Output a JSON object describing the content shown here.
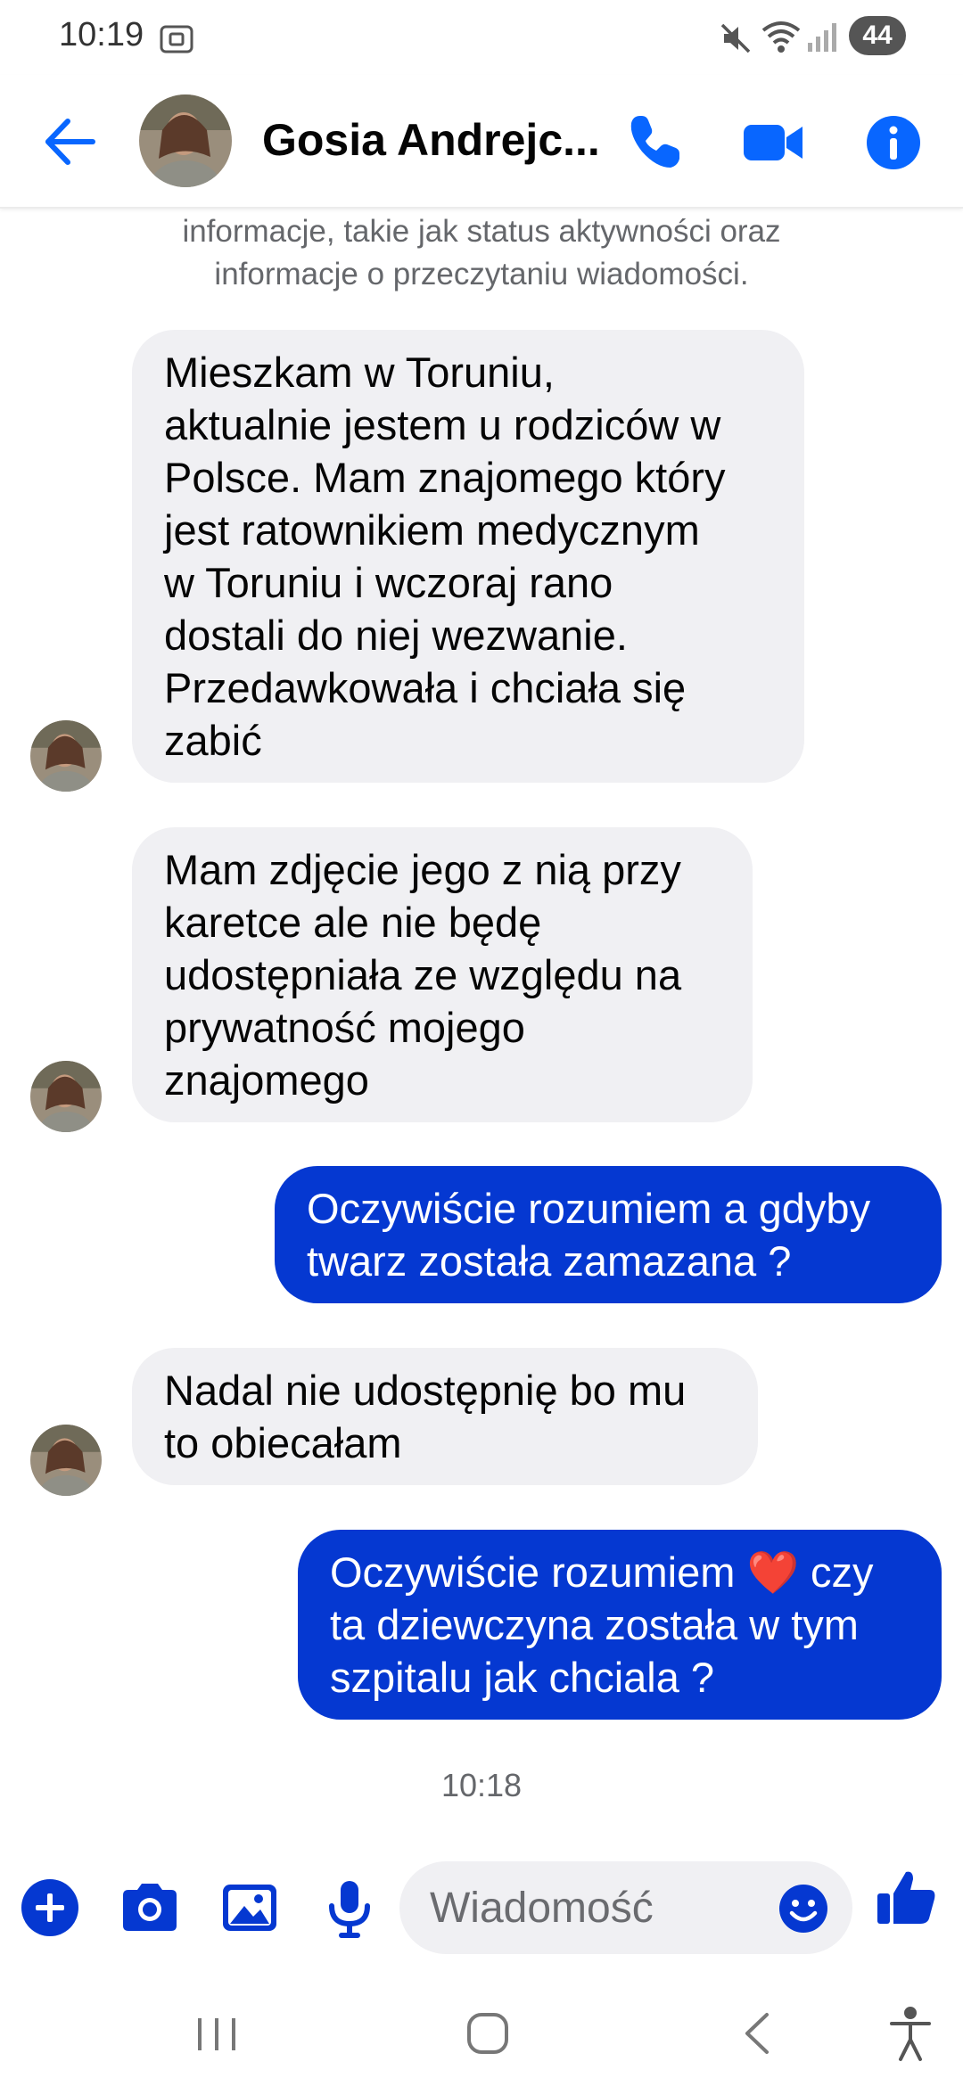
{
  "status_bar": {
    "time": "10:19",
    "battery": "44"
  },
  "header": {
    "contact_name": "Gosia Andrejc..."
  },
  "chat": {
    "notice": "informacje, takie jak status aktywności oraz informacje o przeczytaniu wiadomości.",
    "messages": [
      {
        "from": "contact",
        "lines": [
          "Mieszkam w Toruniu,",
          "aktualnie jestem u rodziców w",
          "Polsce. Mam znajomego który",
          "jest ratownikiem medycznym",
          "w Toruniu i wczoraj rano",
          "dostali do niej wezwanie.",
          "Przedawkowała i chciała się",
          "zabić"
        ]
      },
      {
        "from": "contact",
        "lines": [
          "Mam zdjęcie jego z nią przy",
          "karetce ale nie będę",
          "udostępniała ze względu na",
          "prywatność mojego",
          "znajomego"
        ]
      },
      {
        "from": "me",
        "lines": [
          "Oczywiście rozumiem a gdyby",
          "twarz została zamazana ?"
        ]
      },
      {
        "from": "contact",
        "lines": [
          "Nadal nie udostępnię bo mu",
          "to obiecałam"
        ]
      },
      {
        "from": "me",
        "lines": [
          "Oczywiście rozumiem ❤️ czy",
          "ta dziewczyna została w tym",
          "szpitalu jak chciala ?"
        ]
      }
    ],
    "timestamp": "10:18"
  },
  "composer": {
    "placeholder": "Wiadomość"
  },
  "colors": {
    "accent": "#0866ff",
    "outgoing_bubble": "#0538d1",
    "incoming_bubble": "#f0f0f3",
    "heart": "#e8322a"
  },
  "icons": {
    "back": "arrow-left-icon",
    "call": "phone-icon",
    "video": "video-camera-icon",
    "info": "info-icon",
    "plus": "plus-icon",
    "camera": "camera-icon",
    "gallery": "image-icon",
    "mic": "microphone-icon",
    "emoji": "smiley-icon",
    "like": "thumbs-up-icon"
  }
}
